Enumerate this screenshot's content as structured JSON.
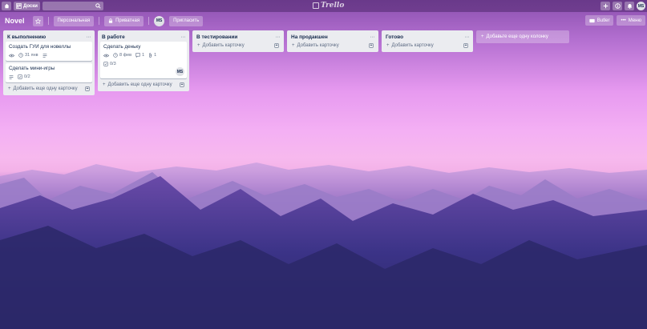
{
  "topbar": {
    "boards_label": "Доски",
    "logo_text": "Trello",
    "avatar_initials": "MS"
  },
  "board": {
    "title": "Novel",
    "personal_label": "Персональная",
    "private_label": "Приватная",
    "member_initials": "MS",
    "invite_label": "Пригласить",
    "butler_label": "Butler",
    "menu_label": "Меню"
  },
  "lists": [
    {
      "title": "К выполнению",
      "cards": [
        {
          "title": "Создать ГУИ для новеллы",
          "date": "31 янв",
          "comments": "",
          "attachments": "",
          "checklist": "",
          "avatar": ""
        },
        {
          "title": "Сделать мини-игры",
          "date": "",
          "comments": "",
          "attachments": "",
          "checklist": "0/2",
          "avatar": ""
        }
      ],
      "add_card_label": "Добавить еще одну карточку"
    },
    {
      "title": "В работе",
      "cards": [
        {
          "title": "Сделать деньку",
          "date": "8 фев",
          "comments": "1",
          "attachments": "1",
          "checklist": "0/3",
          "avatar": "MS"
        }
      ],
      "add_card_label": "Добавить еще одну карточку"
    },
    {
      "title": "В тестировании",
      "cards": [],
      "add_card_label": "Добавить карточку"
    },
    {
      "title": "На продакшен",
      "cards": [],
      "add_card_label": "Добавить карточку"
    },
    {
      "title": "Готово",
      "cards": [],
      "add_card_label": "Добавить карточку"
    }
  ],
  "add_list_label": "Добавьте еще одну колонку"
}
